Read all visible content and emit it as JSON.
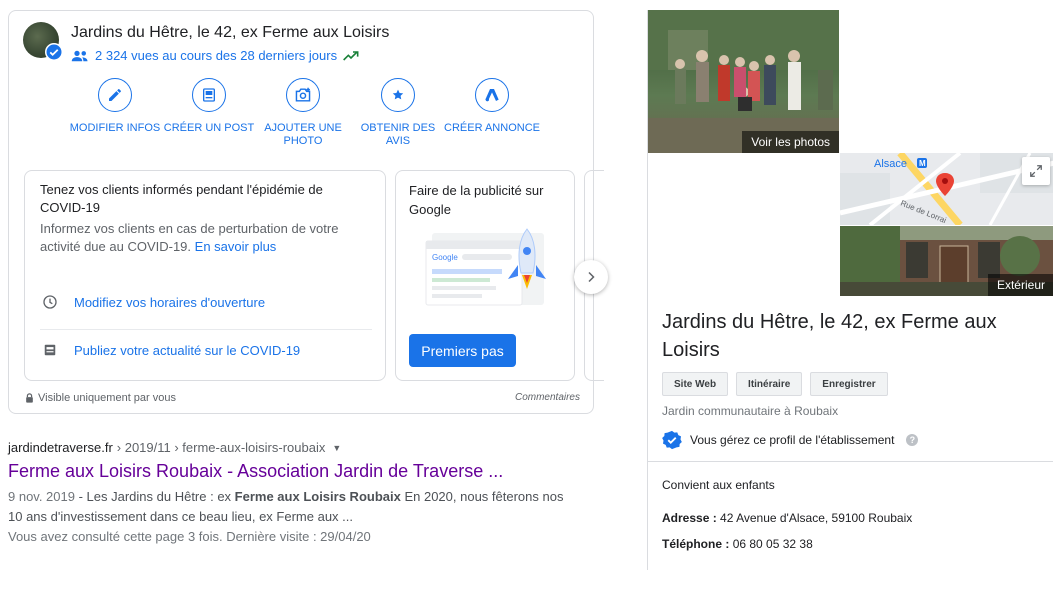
{
  "business": {
    "name": "Jardins du Hêtre, le 42, ex Ferme aux Loisirs",
    "views_text": "2 324 vues au cours des 28 derniers jours"
  },
  "actions": [
    {
      "label": "MODIFIER INFOS",
      "icon": "edit-icon"
    },
    {
      "label": "CRÉER UN POST",
      "icon": "post-icon"
    },
    {
      "label": "AJOUTER UNE PHOTO",
      "icon": "add-photo-icon"
    },
    {
      "label": "OBTENIR DES AVIS",
      "icon": "review-star-icon"
    },
    {
      "label": "CRÉER ANNONCE",
      "icon": "google-ads-icon"
    }
  ],
  "covid_card": {
    "title": "Tenez vos clients informés pendant l'épidémie de COVID-19",
    "description": "Informez vos clients en cas de perturbation de votre activité due au COVID-19.",
    "learn_more": "En savoir plus",
    "rows": [
      {
        "label": "Modifiez vos horaires d'ouverture",
        "icon": "clock-icon"
      },
      {
        "label": "Publiez votre actualité sur le COVID-19",
        "icon": "post-icon"
      }
    ]
  },
  "ads_card": {
    "title": "Faire de la publicité sur Google",
    "illustration_brand": "Google",
    "button": "Premiers pas"
  },
  "footer": {
    "visibility": "Visible uniquement par vous",
    "comments": "Commentaires"
  },
  "result": {
    "domain": "jardindetraverse.fr",
    "path": "› 2019/11 › ferme-aux-loisirs-roubaix",
    "title": "Ferme aux Loisirs Roubaix - Association Jardin de Traverse ...",
    "date": "9 nov. 2019",
    "snippet_a": " - Les Jardins du Hêtre : ex ",
    "snippet_b1": "Ferme aux Loisirs Roubaix",
    "snippet_c": " En 2020, nous fêterons nos 10 ans d'investissement dans ce beau lieu, ex Ferme aux ...",
    "visited": "Vous avez consulté cette page 3 fois. Dernière visite : 29/04/20"
  },
  "panel": {
    "photos_label": "Voir les photos",
    "map_label": "Alsace",
    "map_street": "Rue de Lorrai",
    "exterior_label": "Extérieur",
    "title": "Jardins du Hêtre, le 42, ex Ferme aux Loisirs",
    "buttons": [
      "Site Web",
      "Itinéraire",
      "Enregistrer"
    ],
    "category": "Jardin communautaire à Roubaix",
    "manage_text": "Vous gérez ce profil de l'établissement",
    "kids": "Convient aux enfants",
    "address_label": "Adresse :",
    "address": "42 Avenue d'Alsace, 59100 Roubaix",
    "phone_label": "Téléphone :",
    "phone": "06 80 05 32 38"
  },
  "colors": {
    "accent": "#1a73e8",
    "visited_link": "#660099",
    "map_pin": "#ea4335"
  }
}
